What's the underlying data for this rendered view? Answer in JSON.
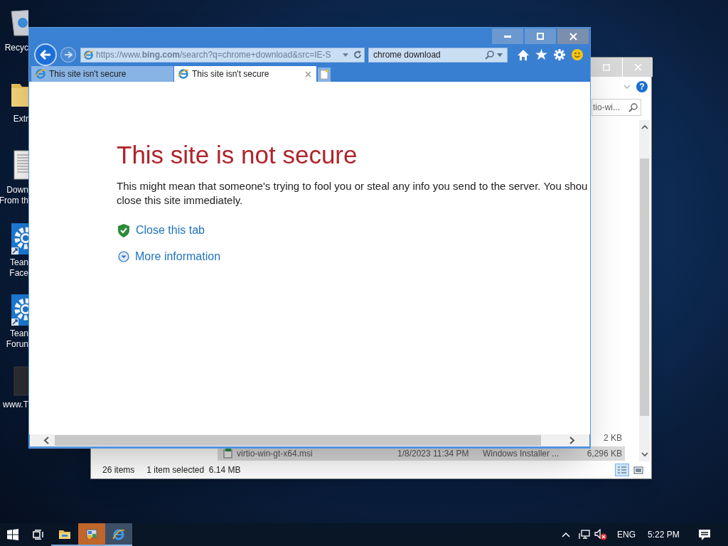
{
  "desktop_icons": [
    {
      "kind": "recycle-bin",
      "label_lines": [
        "Recyc"
      ]
    },
    {
      "kind": "folder",
      "label_lines": [
        "Extr"
      ]
    },
    {
      "kind": "document",
      "label_lines": [
        "Down",
        "From th"
      ]
    },
    {
      "kind": "gear",
      "label_lines": [
        "Tean",
        "Face"
      ]
    },
    {
      "kind": "gear",
      "label_lines": [
        "Tean",
        "Forun"
      ]
    },
    {
      "kind": "dark-file",
      "label_lines": [
        "www.T"
      ]
    }
  ],
  "explorer": {
    "help": "?",
    "search_text": "tio-wi...",
    "rows": [
      {
        "size": "2 KB",
        "selected": false
      },
      {
        "name": "virtio-win-gt-x64.msi",
        "date": "1/8/2023 11:34 PM",
        "type": "Windows Installer ...",
        "size": "6,296 KB",
        "selected": true
      }
    ],
    "status": {
      "count": "26 items",
      "selection": "1 item selected  6.14 MB"
    }
  },
  "browser": {
    "address": "https://www.**bing.com**/search?q=chrome+download&src=IE-S",
    "search": "chrome download",
    "tabs": [
      {
        "title": "This site isn't secure",
        "selected": false
      },
      {
        "title": "This site isn't secure",
        "selected": true
      }
    ],
    "heading": "This site is not secure",
    "paragraph": "This might mean that someone's trying to fool you or steal any info you send to the server. You shou\nclose this site immediately.",
    "links": [
      {
        "kind": "shield",
        "text": "Close this tab"
      },
      {
        "kind": "expand",
        "text": "More information"
      }
    ]
  },
  "taskbar": {
    "apps": [
      {
        "kind": "explorer",
        "selected": false
      },
      {
        "kind": "control-panel",
        "selected": false
      },
      {
        "kind": "ie",
        "selected": true
      }
    ],
    "language": "ENG",
    "time": "5:22 PM"
  }
}
